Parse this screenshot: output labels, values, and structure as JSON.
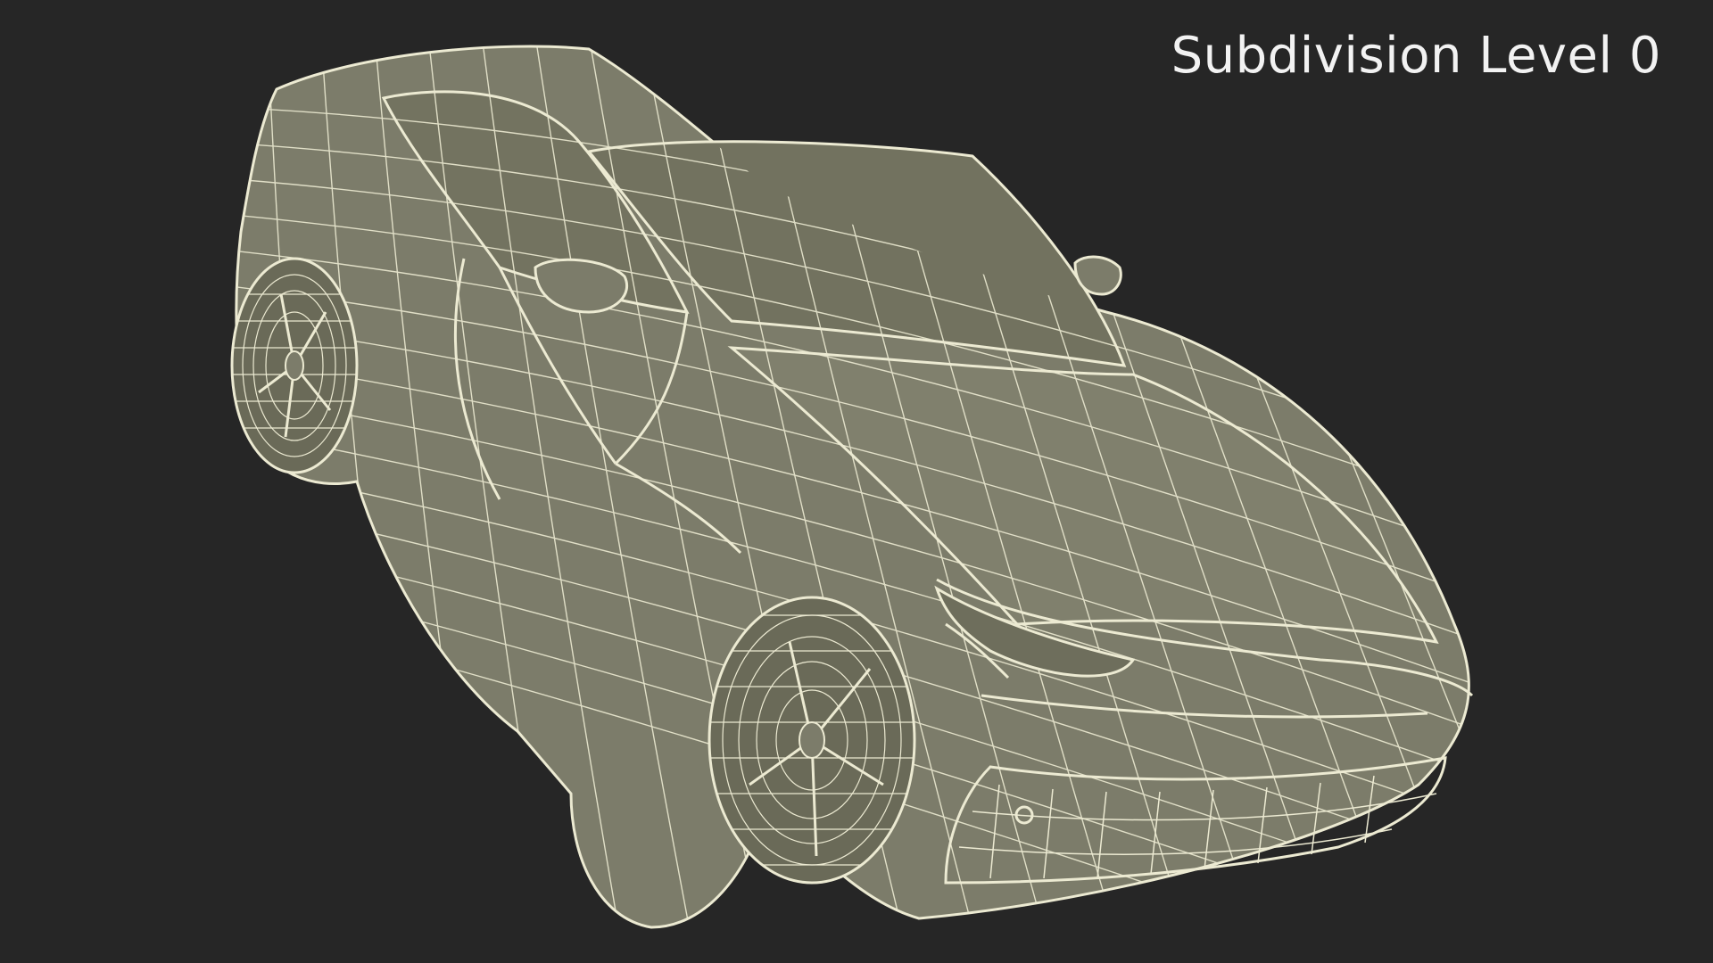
{
  "overlay": {
    "label": "Subdivision Level 0"
  },
  "colors": {
    "background": "#262626",
    "surface": "#7c7c6a",
    "wire": "#ecead2",
    "label": "#f2f2f2"
  },
  "scene": {
    "subject": "car-wireframe-mesh",
    "view": "front-three-quarter"
  }
}
